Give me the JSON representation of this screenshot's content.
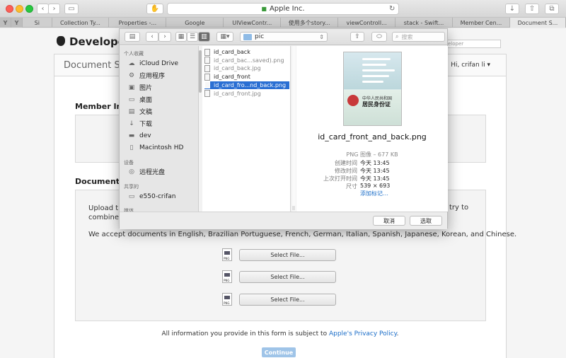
{
  "browser": {
    "url": "Apple Inc.",
    "tabs": [
      {
        "label": "Y",
        "pinned": true
      },
      {
        "label": "Y",
        "pinned": true
      },
      {
        "label": "Si"
      },
      {
        "label": "Collection Ty..."
      },
      {
        "label": "Properties -..."
      },
      {
        "label": "Google"
      },
      {
        "label": "UIViewContr..."
      },
      {
        "label": "使用多个story..."
      },
      {
        "label": "viewControll..."
      },
      {
        "label": "stack - Swift..."
      },
      {
        "label": "Member Cen..."
      },
      {
        "label": "Document S...",
        "active": true
      }
    ]
  },
  "page": {
    "brand": "Developer",
    "search_placeholder": "eloper",
    "subheader_title": "Document Su",
    "user_menu": "Hi, crifan li",
    "section_member": "Member Info",
    "section_documents": "Documents",
    "upload_text": "Upload th",
    "upload_text_2": "combine a",
    "upload_right": "try to",
    "accept_text": "We accept documents in English, Brazilian Portuguese, French, German, Italian, Spanish, Japanese, Korean, and Chinese.",
    "select_file": "Select File...",
    "png_label": "PNG",
    "footer_text": "All information you provide in this form is subject to",
    "footer_link": "Apple's Privacy Policy",
    "footer_end": ".",
    "continue": "Continue"
  },
  "dialog": {
    "path": "pic",
    "search_placeholder": "搜索",
    "sidebar": {
      "favorites_header": "个人收藏",
      "favorites": [
        {
          "label": "iCloud Drive",
          "icon": "cloud-icon"
        },
        {
          "label": "应用程序",
          "icon": "applications-icon"
        },
        {
          "label": "图片",
          "icon": "camera-icon"
        },
        {
          "label": "桌面",
          "icon": "desktop-icon"
        },
        {
          "label": "文稿",
          "icon": "documents-icon"
        },
        {
          "label": "下载",
          "icon": "download-icon"
        },
        {
          "label": "dev",
          "icon": "folder-icon"
        },
        {
          "label": "Macintosh HD",
          "icon": "disk-icon"
        }
      ],
      "devices_header": "设备",
      "devices": [
        {
          "label": "远程光盘",
          "icon": "disc-icon"
        }
      ],
      "shared_header": "共享的",
      "shared": [
        {
          "label": "e550-crifan",
          "icon": "computer-icon"
        }
      ],
      "media_header": "媒体"
    },
    "files": [
      {
        "name": "id_card_back",
        "dim": false,
        "selected": false
      },
      {
        "name": "id_card_bac...saved).png",
        "dim": true,
        "selected": false
      },
      {
        "name": "id_card_back.jpg",
        "dim": true,
        "selected": false
      },
      {
        "name": "id_card_front",
        "dim": false,
        "selected": false
      },
      {
        "name": "id_card_fro...nd_back.png",
        "dim": false,
        "selected": true
      },
      {
        "name": "id_card_front.jpg",
        "dim": true,
        "selected": false
      }
    ],
    "preview": {
      "name": "id_card_front_and_back.png",
      "kind": "PNG 图像 – 677 KB",
      "meta": [
        {
          "label": "创建时间",
          "value": "今天 13:45"
        },
        {
          "label": "修改时间",
          "value": "今天 13:45"
        },
        {
          "label": "上次打开时间",
          "value": "今天 13:45"
        },
        {
          "label": "尺寸",
          "value": "539 × 693"
        }
      ],
      "add_tags": "添加标记…",
      "card_text_1": "中华人民共和国",
      "card_text_2": "居民身份证"
    },
    "cancel": "取消",
    "choose": "选取"
  }
}
